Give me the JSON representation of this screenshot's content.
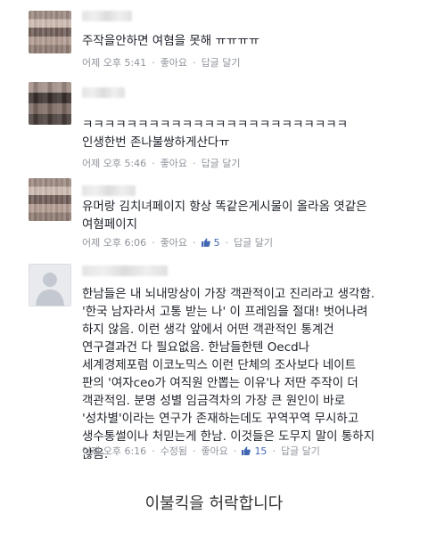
{
  "comments": [
    {
      "text": "주작을안하면 여혐을 못해 ㅠㅠㅠㅠ",
      "time": "어제 오후 5:41",
      "like": "좋아요",
      "reply": "답글 달기"
    },
    {
      "text": "ㅋㅋㅋㅋㅋㅋㅋㅋㅋㅋㅋㅋㅋㅋㅋㅋㅋㅋㅋㅋㅋㅋㅋㅋ\n인생한번 존나불쌍하게산다ㅠ",
      "time": "어제 오후 5:46",
      "like": "좋아요",
      "reply": "답글 달기"
    },
    {
      "text": "유머랑 김치녀페이지 항상 똑같은게시물이 올라옴 엿같은\n여혐페이지",
      "time": "어제 오후 6:06",
      "like": "좋아요",
      "like_count": "5",
      "reply": "답글 달기"
    },
    {
      "text": "한남들은 내 뇌내망상이 가장 객관적이고 진리라고 생각함.\n'한국 남자라서 고통 받는 나' 이 프레임을 절대! 벗어나려\n하지 않음. 이런 생각 앞에서 어떤 객관적인 통계건\n연구결과건 다 필요없음. 한남들한텐 Oecd나\n세계경제포럼 이코노믹스 이런 단체의 조사보다 네이트\n판의 '여자ceo가 여직원 안뽑는 이유'나 저딴 주작이 더\n객관적임. 분명 성별 임금격차의 가장 큰 원인이 바로\n'성차별'이라는 연구가 존재하는데도 꾸역꾸역 무시하고\n생수통썰이나 처믿는게 한남. 이것들은 도무지 말이 통하지\n않음.",
      "time": "어제 오후 6:16",
      "edited": "수정됨",
      "like": "좋아요",
      "like_count": "15",
      "reply": "답글 달기"
    }
  ],
  "footer": "이불킥을 허락합니다",
  "colors": {
    "meta": "#90949c",
    "like_count": "#4267b2"
  },
  "icons": [
    "avatar-placeholder-icon",
    "thumbs-up-icon"
  ]
}
